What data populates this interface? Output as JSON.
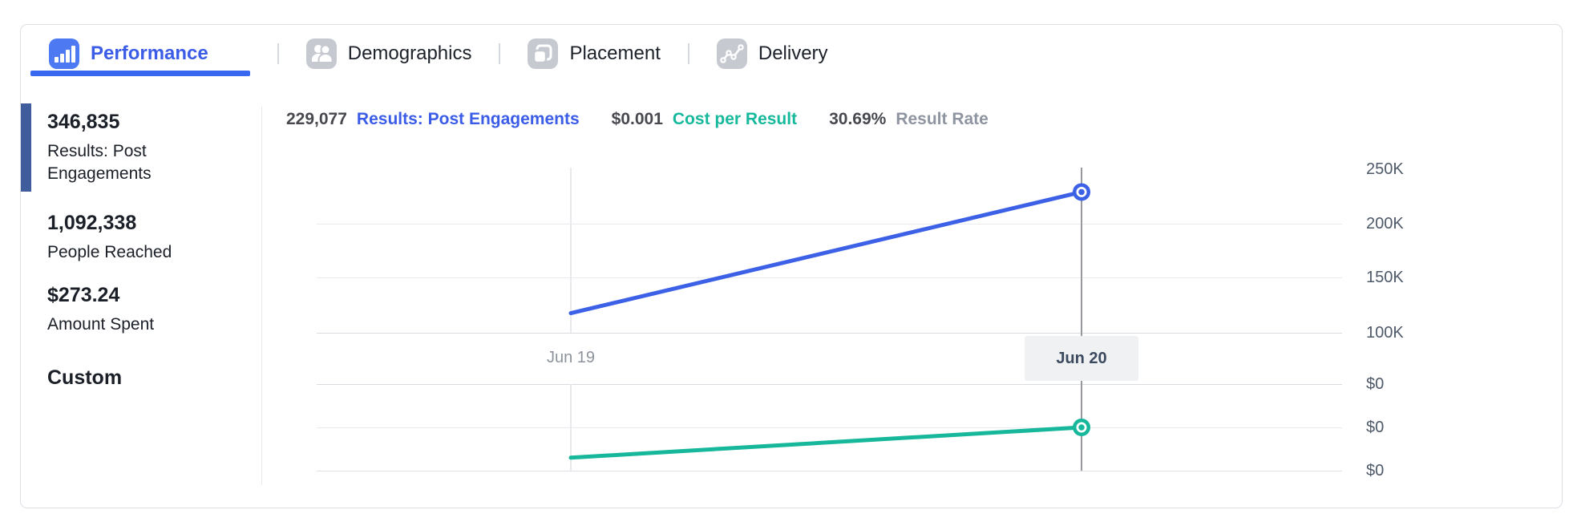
{
  "tabs": {
    "items": [
      {
        "label": "Performance",
        "icon": "bar-chart-icon",
        "active": true
      },
      {
        "label": "Demographics",
        "icon": "people-icon",
        "active": false
      },
      {
        "label": "Placement",
        "icon": "frames-icon",
        "active": false
      },
      {
        "label": "Delivery",
        "icon": "trend-icon",
        "active": false
      }
    ]
  },
  "sidebar": {
    "metrics": [
      {
        "value": "346,835",
        "label": "Results: Post Engagements",
        "selected": true
      },
      {
        "value": "1,092,338",
        "label": "People Reached",
        "selected": false
      },
      {
        "value": "$273.24",
        "label": "Amount Spent",
        "selected": false
      }
    ],
    "footer_label": "Custom"
  },
  "header": {
    "metrics": [
      {
        "value": "229,077",
        "label": "Results: Post Engagements",
        "color": "#3a5ce6"
      },
      {
        "value": "$0.001",
        "label": "Cost per Result",
        "color": "#17b99d"
      },
      {
        "value": "30.69%",
        "label": "Result Rate",
        "color": "#8f95a0"
      }
    ]
  },
  "chart_data": {
    "type": "line",
    "x": [
      "Jun 19",
      "Jun 20"
    ],
    "selected_x": "Jun 20",
    "series": [
      {
        "name": "Results: Post Engagements",
        "color": "#3c60e6",
        "values": [
          118000,
          229077
        ],
        "axis": {
          "min": 100000,
          "max": 250000
        }
      },
      {
        "name": "Cost per Result",
        "color": "#16b79a",
        "values": [
          0.0003,
          0.001
        ],
        "axis": {
          "min": 0,
          "max": 0.002
        }
      }
    ],
    "y_axis_labels": [
      "250K",
      "200K",
      "150K",
      "100K",
      "$0",
      "$0",
      "$0"
    ],
    "grid": true,
    "legend_position": "none"
  }
}
